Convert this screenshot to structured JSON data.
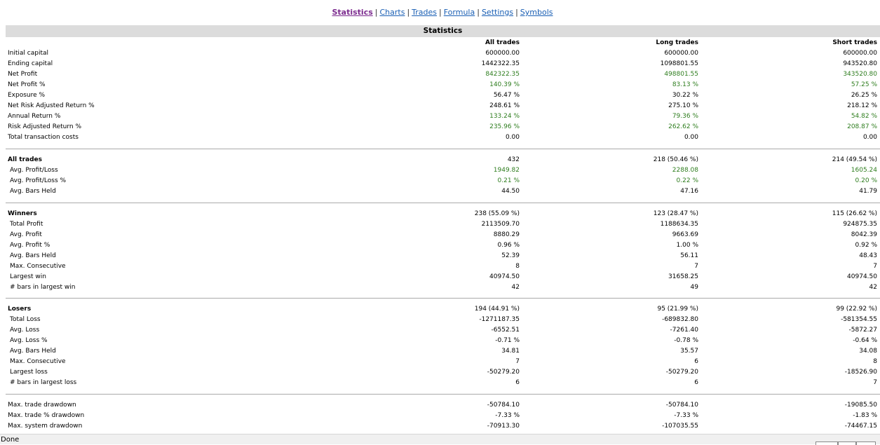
{
  "nav": {
    "links": [
      "Statistics",
      "Charts",
      "Trades",
      "Formula",
      "Settings",
      "Symbols"
    ],
    "separator": "|"
  },
  "header": {
    "title": "Statistics"
  },
  "columns": {
    "all": "All trades",
    "long": "Long trades",
    "short": "Short trades"
  },
  "summary": [
    {
      "label": "Initial capital",
      "values": [
        "600000.00",
        "600000.00",
        "600000.00"
      ],
      "green": false
    },
    {
      "label": "Ending capital",
      "values": [
        "1442322.35",
        "1098801.55",
        "943520.80"
      ],
      "green": false
    },
    {
      "label": "Net Profit",
      "values": [
        "842322.35",
        "498801.55",
        "343520.80"
      ],
      "green": true
    },
    {
      "label": "Net Profit %",
      "values": [
        "140.39 %",
        "83.13 %",
        "57.25 %"
      ],
      "green": true
    },
    {
      "label": "Exposure %",
      "values": [
        "56.47 %",
        "30.22 %",
        "26.25 %"
      ],
      "green": false
    },
    {
      "label": "Net Risk Adjusted Return %",
      "values": [
        "248.61 %",
        "275.10 %",
        "218.12 %"
      ],
      "green": false
    },
    {
      "label": "Annual Return %",
      "values": [
        "133.24 %",
        "79.36 %",
        "54.82 %"
      ],
      "green": true
    },
    {
      "label": "Risk Adjusted Return %",
      "values": [
        "235.96 %",
        "262.62 %",
        "208.87 %"
      ],
      "green": true
    },
    {
      "label": "Total transaction costs",
      "values": [
        "0.00",
        "0.00",
        "0.00"
      ],
      "green": false
    }
  ],
  "all_trades": [
    {
      "label": "All trades",
      "values": [
        "432",
        "218 (50.46 %)",
        "214 (49.54 %)"
      ],
      "green": false,
      "bold": true
    },
    {
      "label": "Avg. Profit/Loss",
      "values": [
        "1949.82",
        "2288.08",
        "1605.24"
      ],
      "green": true
    },
    {
      "label": "Avg. Profit/Loss %",
      "values": [
        "0.21 %",
        "0.22 %",
        "0.20 %"
      ],
      "green": true
    },
    {
      "label": "Avg. Bars Held",
      "values": [
        "44.50",
        "47.16",
        "41.79"
      ],
      "green": false
    }
  ],
  "winners": [
    {
      "label": "Winners",
      "values": [
        "238 (55.09 %)",
        "123 (28.47 %)",
        "115 (26.62 %)"
      ],
      "green": false,
      "bold": true
    },
    {
      "label": "Total Profit",
      "values": [
        "2113509.70",
        "1188634.35",
        "924875.35"
      ],
      "green": false
    },
    {
      "label": "Avg. Profit",
      "values": [
        "8880.29",
        "9663.69",
        "8042.39"
      ],
      "green": false
    },
    {
      "label": "Avg. Profit %",
      "values": [
        "0.96 %",
        "1.00 %",
        "0.92 %"
      ],
      "green": false
    },
    {
      "label": "Avg. Bars Held",
      "values": [
        "52.39",
        "56.11",
        "48.43"
      ],
      "green": false
    },
    {
      "label": "Max. Consecutive",
      "values": [
        "8",
        "7",
        "7"
      ],
      "green": false
    },
    {
      "label": "Largest win",
      "values": [
        "40974.50",
        "31658.25",
        "40974.50"
      ],
      "green": false
    },
    {
      "label": "# bars in largest win",
      "values": [
        "42",
        "49",
        "42"
      ],
      "green": false
    }
  ],
  "losers": [
    {
      "label": "Losers",
      "values": [
        "194 (44.91 %)",
        "95 (21.99 %)",
        "99 (22.92 %)"
      ],
      "green": false,
      "bold": true
    },
    {
      "label": "Total Loss",
      "values": [
        "-1271187.35",
        "-689832.80",
        "-581354.55"
      ],
      "green": false
    },
    {
      "label": "Avg. Loss",
      "values": [
        "-6552.51",
        "-7261.40",
        "-5872.27"
      ],
      "green": false
    },
    {
      "label": "Avg. Loss %",
      "values": [
        "-0.71 %",
        "-0.78 %",
        "-0.64 %"
      ],
      "green": false
    },
    {
      "label": "Avg. Bars Held",
      "values": [
        "34.81",
        "35.57",
        "34.08"
      ],
      "green": false
    },
    {
      "label": "Max. Consecutive",
      "values": [
        "7",
        "6",
        "8"
      ],
      "green": false
    },
    {
      "label": "Largest loss",
      "values": [
        "-50279.20",
        "-50279.20",
        "-18526.90"
      ],
      "green": false
    },
    {
      "label": "# bars in largest loss",
      "values": [
        "6",
        "6",
        "7"
      ],
      "green": false
    }
  ],
  "drawdown": [
    {
      "label": "Max. trade drawdown",
      "values": [
        "-50784.10",
        "-50784.10",
        "-19085.50"
      ],
      "green": false
    },
    {
      "label": "Max. trade % drawdown",
      "values": [
        "-7.33 %",
        "-7.33 %",
        "-1.83 %"
      ],
      "green": false
    },
    {
      "label": "Max. system drawdown",
      "values": [
        "-70913.30",
        "-107035.55",
        "-74467.15"
      ],
      "green": false
    }
  ],
  "status": {
    "text": "Done"
  },
  "colors": {
    "green": "#2e7d1e",
    "link": "#1a5fb4",
    "visited": "#7b2a8e",
    "header_bg": "#dcdcdc"
  }
}
